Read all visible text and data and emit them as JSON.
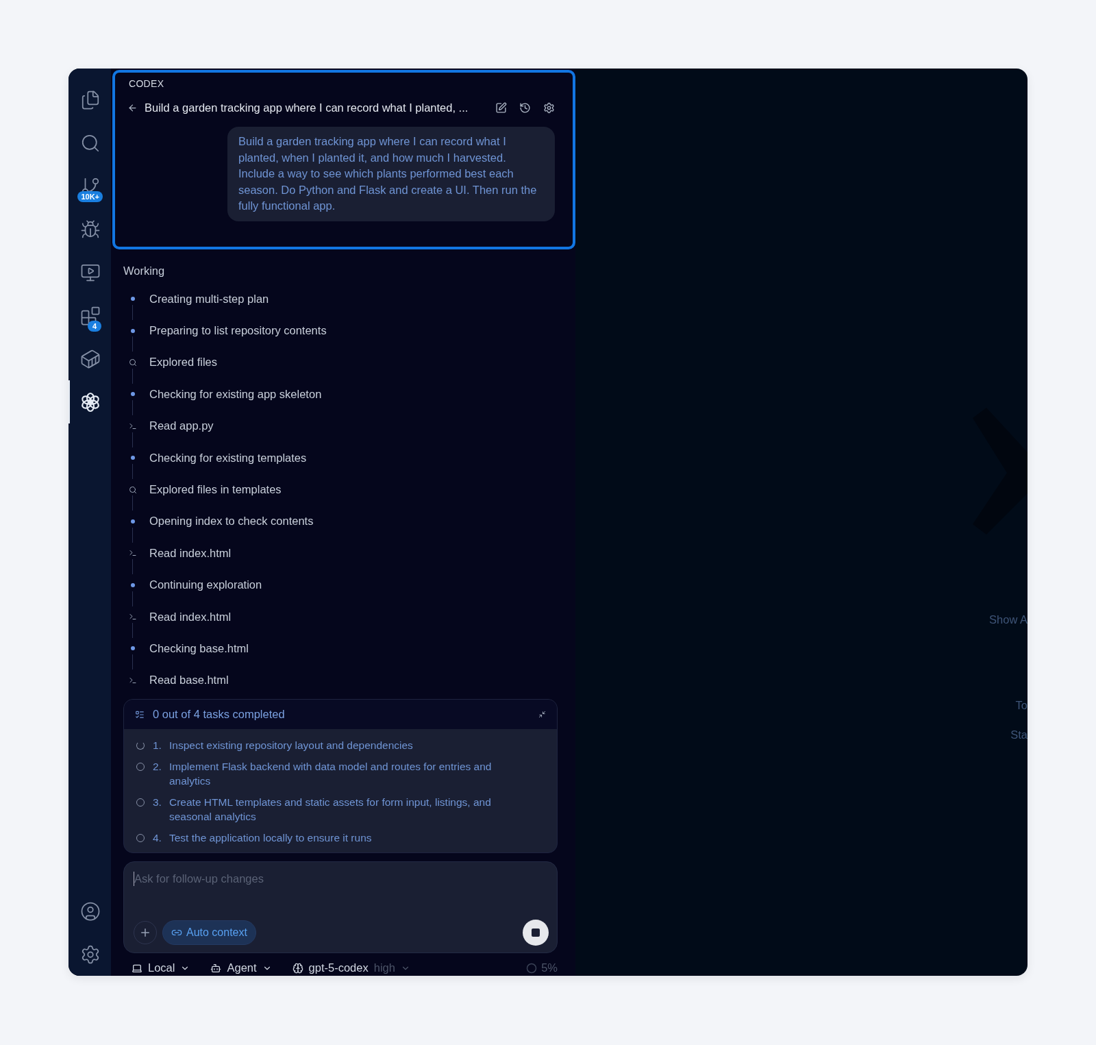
{
  "activity_bar": {
    "items": [
      {
        "kind": "files",
        "selected": false
      },
      {
        "kind": "search",
        "selected": false
      },
      {
        "kind": "source-control",
        "selected": false,
        "badge": "10K+"
      },
      {
        "kind": "run-debug",
        "selected": false
      },
      {
        "kind": "remote",
        "selected": false
      },
      {
        "kind": "extensions",
        "selected": false,
        "badge": "4"
      },
      {
        "kind": "containers",
        "selected": false
      },
      {
        "kind": "codex",
        "selected": true
      }
    ],
    "bottom_items": [
      {
        "kind": "account"
      },
      {
        "kind": "settings"
      }
    ]
  },
  "panel": {
    "title": "CODEX",
    "header": {
      "highlighted": true,
      "thread_title": "Build a garden tracking app where I can record what I planted, ..."
    },
    "prompt": "Build a garden tracking app where I can record what I planted, when I planted it, and how much I harvested. Include a way to see which plants performed best each season. Do Python and Flask and create a UI. Then run the fully functional app.",
    "status": "Working",
    "steps": [
      {
        "kind": "step",
        "text": "Creating multi-step plan"
      },
      {
        "kind": "step",
        "text": "Preparing to list repository contents"
      },
      {
        "kind": "search",
        "text": "Explored files"
      },
      {
        "kind": "step",
        "text": "Checking for existing app skeleton"
      },
      {
        "kind": "read",
        "text": "Read app.py"
      },
      {
        "kind": "step",
        "text": "Checking for existing templates"
      },
      {
        "kind": "search",
        "text": "Explored files in templates"
      },
      {
        "kind": "step",
        "text": "Opening index to check contents"
      },
      {
        "kind": "read",
        "text": "Read index.html"
      },
      {
        "kind": "step",
        "text": "Continuing exploration"
      },
      {
        "kind": "read",
        "text": "Read index.html"
      },
      {
        "kind": "step",
        "text": "Checking base.html"
      },
      {
        "kind": "read",
        "text": "Read base.html"
      }
    ],
    "tasks": {
      "summary": "0 out of 4 tasks completed",
      "items": [
        {
          "number": "1.",
          "text": "Inspect existing repository layout and dependencies",
          "in_progress": true
        },
        {
          "number": "2.",
          "text": "Implement Flask backend with data model and routes for entries and analytics",
          "in_progress": false
        },
        {
          "number": "3.",
          "text": "Create HTML templates and static assets for form input, listings, and seasonal analytics",
          "in_progress": false
        },
        {
          "number": "4.",
          "text": "Test the application locally to ensure it runs",
          "in_progress": false
        }
      ]
    },
    "composer": {
      "placeholder": "Ask for follow-up changes",
      "context_chip": "Auto context"
    },
    "footer": {
      "environment": "Local",
      "mode": "Agent",
      "model": "gpt-5-codex",
      "effort": "high",
      "context_usage": "5%"
    }
  },
  "editor": {
    "hints": [
      "Show A",
      "To",
      "Sta"
    ]
  }
}
